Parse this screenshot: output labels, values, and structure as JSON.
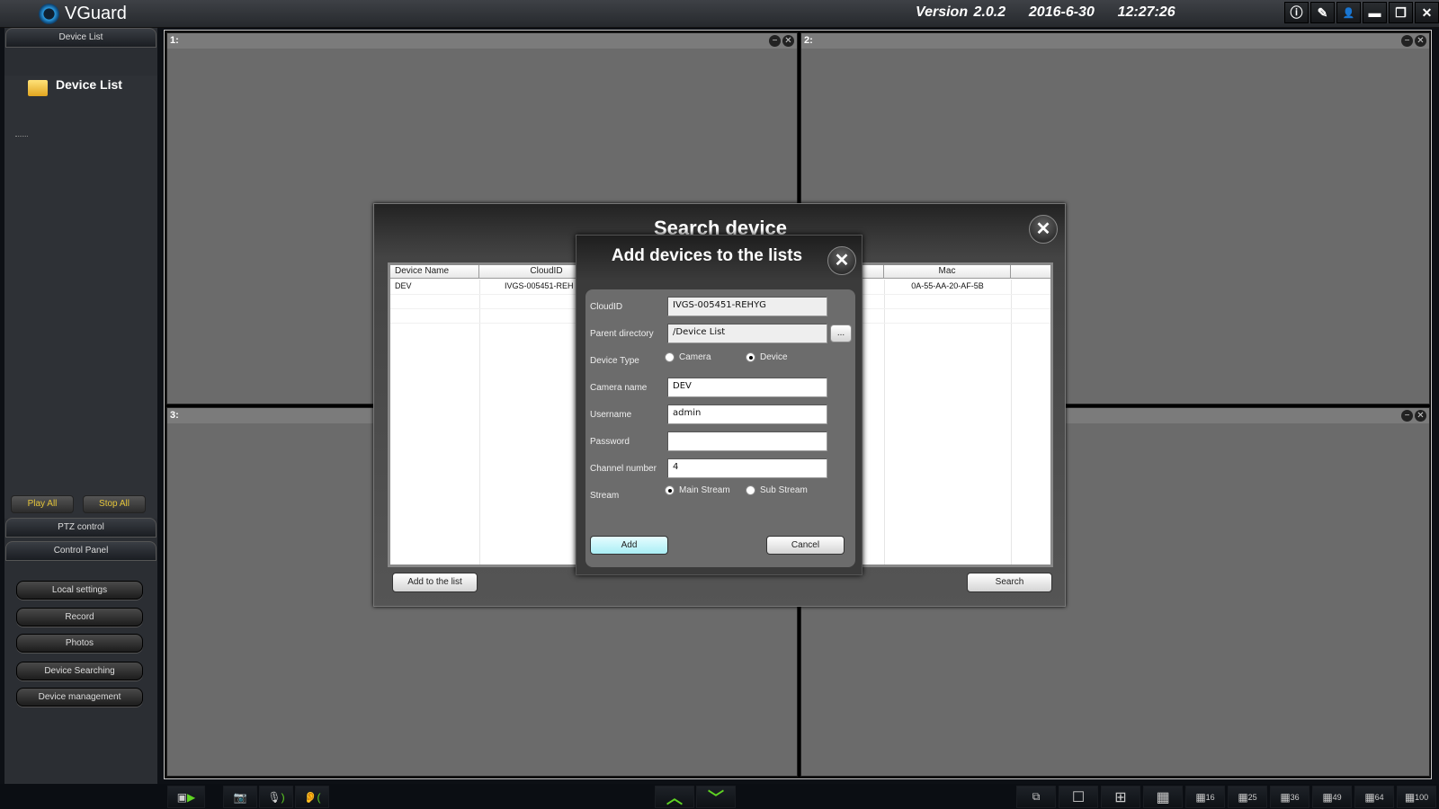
{
  "app": {
    "title": "VGuard",
    "version_line": "Version 2.0.2    2016-6-30    12:27:26"
  },
  "window_buttons": [
    {
      "icon": "info-icon",
      "glyph": "ⓘ"
    },
    {
      "icon": "edit-icon",
      "glyph": "✎"
    },
    {
      "icon": "user-settings-icon",
      "glyph": "👤"
    },
    {
      "icon": "minimize-icon",
      "glyph": "▬"
    },
    {
      "icon": "restore-icon",
      "glyph": "❐"
    },
    {
      "icon": "close-icon",
      "glyph": "✕"
    }
  ],
  "sidebar": {
    "device_list_tab": "Device List",
    "tree_root": "Device List",
    "play_all": "Play All",
    "stop_all": "Stop All",
    "ptz_tab": "PTZ control",
    "control_tab": "Control Panel",
    "buttons": [
      "Local settings",
      "Record",
      "Photos",
      "Device Searching",
      "Device management"
    ]
  },
  "panes": [
    "1:",
    "2:",
    "3:",
    ""
  ],
  "search_dialog": {
    "title": "Search device",
    "columns": [
      "Device Name",
      "CloudID",
      "Mac"
    ],
    "rows": [
      {
        "name": "DEV",
        "cloudid": "IVGS-005451-REH",
        "mac": "0A-55-AA-20-AF-5B"
      }
    ],
    "add_to_list": "Add to the list",
    "search": "Search"
  },
  "add_dialog": {
    "title": "Add devices to the lists",
    "labels": {
      "cloudid": "CloudID",
      "parent": "Parent directory",
      "type": "Device Type",
      "name": "Camera name",
      "username": "Username",
      "password": "Password",
      "channel": "Channel number",
      "stream": "Stream"
    },
    "values": {
      "cloudid": "IVGS-005451-REHYG",
      "parent": "/Device List",
      "name": "DEV",
      "username": "admin",
      "password": "",
      "channel": "4"
    },
    "browse": "...",
    "device_type": {
      "options": [
        "Camera",
        "Device"
      ],
      "selected": "Device"
    },
    "stream": {
      "options": [
        "Main Stream",
        "Sub Stream"
      ],
      "selected": "Main Stream"
    },
    "add": "Add",
    "cancel": "Cancel"
  },
  "bottom": {
    "layouts": [
      "",
      "",
      "",
      "",
      "16",
      "25",
      "36",
      "49",
      "64",
      "100"
    ]
  },
  "colors": {
    "accent_add_button": "#bff6fb",
    "play_text": "#e4c43a",
    "green_icons": "#5fd323"
  }
}
